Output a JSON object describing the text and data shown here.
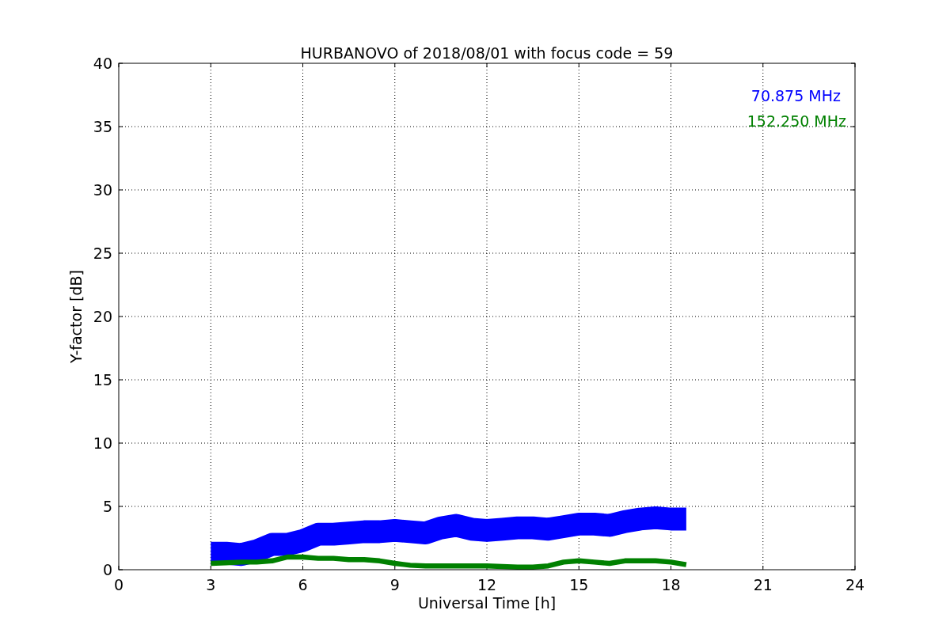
{
  "chart_data": {
    "type": "line",
    "title": "HURBANOVO of 2018/08/01 with focus code = 59",
    "xlabel": "Universal Time [h]",
    "ylabel": "Y-factor [dB]",
    "x": [
      3,
      3.5,
      4,
      4.5,
      5,
      5.5,
      6,
      6.5,
      7,
      7.5,
      8,
      8.5,
      9,
      9.5,
      10,
      10.5,
      11,
      11.5,
      12,
      12.5,
      13,
      13.5,
      14,
      14.5,
      15,
      15.5,
      16,
      16.5,
      17,
      17.5,
      18,
      18.5
    ],
    "series": [
      {
        "name": "70.875 MHz",
        "color": "#0000ff",
        "values": [
          1.3,
          1.3,
          1.2,
          1.5,
          2,
          2,
          2.3,
          2.8,
          2.8,
          2.9,
          3,
          3,
          3.1,
          3,
          2.9,
          3.3,
          3.5,
          3.2,
          3.1,
          3.2,
          3.3,
          3.3,
          3.2,
          3.4,
          3.6,
          3.6,
          3.5,
          3.8,
          4,
          4.1,
          4,
          4
        ]
      },
      {
        "name": "152.250 MHz",
        "color": "#008000",
        "values": [
          0.5,
          0.55,
          0.6,
          0.6,
          0.7,
          1,
          1,
          0.9,
          0.9,
          0.8,
          0.8,
          0.7,
          0.5,
          0.35,
          0.3,
          0.3,
          0.3,
          0.3,
          0.3,
          0.25,
          0.2,
          0.2,
          0.3,
          0.6,
          0.7,
          0.6,
          0.5,
          0.7,
          0.7,
          0.7,
          0.6,
          0.4
        ]
      }
    ],
    "xlim": [
      0,
      24
    ],
    "ylim": [
      0,
      40
    ],
    "xticks": [
      0,
      3,
      6,
      9,
      12,
      15,
      18,
      21,
      24
    ],
    "yticks": [
      0,
      5,
      10,
      15,
      20,
      25,
      30,
      35,
      40
    ],
    "grid": true
  }
}
